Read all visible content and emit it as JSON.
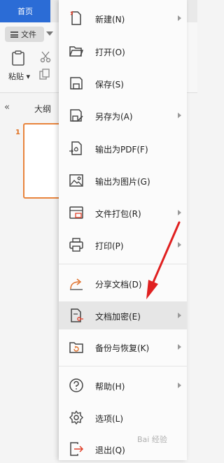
{
  "app": {
    "home_tab": "首页",
    "file_button": "文件",
    "paste_label": "粘贴",
    "outline_label": "大纲",
    "slide_number": "1"
  },
  "menu": {
    "items": [
      {
        "label": "新建(N)",
        "icon": "new-icon",
        "has_submenu": true
      },
      {
        "label": "打开(O)",
        "icon": "folder-open-icon",
        "has_submenu": false
      },
      {
        "label": "保存(S)",
        "icon": "save-icon",
        "has_submenu": false
      },
      {
        "label": "另存为(A)",
        "icon": "save-as-icon",
        "has_submenu": true
      },
      {
        "label": "输出为PDF(F)",
        "icon": "pdf-export-icon",
        "has_submenu": false
      },
      {
        "label": "输出为图片(G)",
        "icon": "image-export-icon",
        "has_submenu": false
      },
      {
        "label": "文件打包(R)",
        "icon": "package-icon",
        "has_submenu": true
      },
      {
        "label": "打印(P)",
        "icon": "printer-icon",
        "has_submenu": true
      },
      {
        "label": "分享文档(D)",
        "icon": "share-icon",
        "has_submenu": false
      },
      {
        "label": "文档加密(E)",
        "icon": "encrypt-icon",
        "has_submenu": true,
        "highlighted": true
      },
      {
        "label": "备份与恢复(K)",
        "icon": "backup-icon",
        "has_submenu": true
      },
      {
        "label": "帮助(H)",
        "icon": "help-icon",
        "has_submenu": true
      },
      {
        "label": "选项(L)",
        "icon": "gear-icon",
        "has_submenu": false
      },
      {
        "label": "退出(Q)",
        "icon": "exit-icon",
        "has_submenu": false
      }
    ]
  },
  "colors": {
    "accent": "#2b6cd6",
    "thumb_border": "#e8843c",
    "annotation_arrow": "#e02020"
  },
  "watermark": "Bai 经验"
}
